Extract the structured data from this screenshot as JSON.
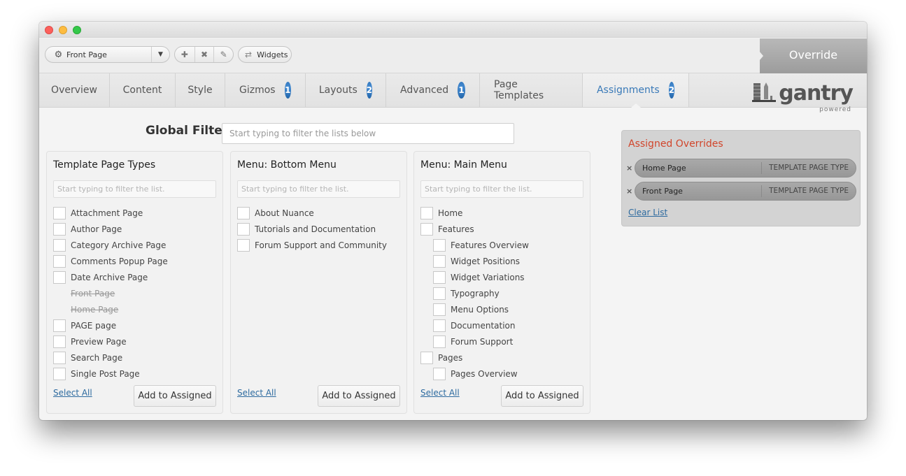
{
  "window": {
    "controls": [
      "close",
      "minimize",
      "maximize"
    ]
  },
  "toolbar": {
    "page_select": {
      "icon": "gear-icon",
      "value": "Front Page",
      "arrow": "▼"
    },
    "actions": [
      {
        "name": "add",
        "icon": "plus-icon",
        "glyph": "✚"
      },
      {
        "name": "delete",
        "icon": "x-icon",
        "glyph": "✖"
      },
      {
        "name": "rename",
        "icon": "pencil-icon",
        "glyph": "✎"
      }
    ],
    "widgets": {
      "icon": "refresh-icon",
      "glyph": "⇄",
      "label": "Widgets"
    },
    "override_label": "Override"
  },
  "tabs": [
    {
      "label": "Overview",
      "badge": null
    },
    {
      "label": "Content",
      "badge": null
    },
    {
      "label": "Style",
      "badge": null
    },
    {
      "label": "Gizmos",
      "badge": "1"
    },
    {
      "label": "Layouts",
      "badge": "2"
    },
    {
      "label": "Advanced",
      "badge": "1"
    },
    {
      "label": "Page Templates",
      "badge": null
    },
    {
      "label": "Assignments",
      "badge": "2",
      "active": true
    }
  ],
  "logo": {
    "brand": "gantry",
    "tagline": "powered"
  },
  "global_filter": {
    "label": "Global Filter",
    "placeholder": "Start typing to filter the lists below"
  },
  "panels": [
    {
      "title": "Template Page Types",
      "filter_placeholder": "Start typing to filter the list.",
      "items": [
        {
          "label": "Attachment Page",
          "state": "normal"
        },
        {
          "label": "Author Page",
          "state": "normal"
        },
        {
          "label": "Category Archive Page",
          "state": "normal"
        },
        {
          "label": "Comments Popup Page",
          "state": "normal"
        },
        {
          "label": "Date Archive Page",
          "state": "normal"
        },
        {
          "label": "Front Page",
          "state": "assigned"
        },
        {
          "label": "Home Page",
          "state": "assigned"
        },
        {
          "label": "PAGE page",
          "state": "normal"
        },
        {
          "label": "Preview Page",
          "state": "normal"
        },
        {
          "label": "Search Page",
          "state": "normal"
        },
        {
          "label": "Single Post Page",
          "state": "normal"
        }
      ],
      "select_all": "Select All",
      "add_button": "Add to Assigned"
    },
    {
      "title": "Menu: Bottom Menu",
      "filter_placeholder": "Start typing to filter the list.",
      "items": [
        {
          "label": "About Nuance",
          "state": "normal"
        },
        {
          "label": "Tutorials and Documentation",
          "state": "normal"
        },
        {
          "label": "Forum Support and Community",
          "state": "normal"
        }
      ],
      "select_all": "Select All",
      "add_button": "Add to Assigned"
    },
    {
      "title": "Menu: Main Menu",
      "filter_placeholder": "Start typing to filter the list.",
      "items": [
        {
          "label": "Home",
          "state": "normal"
        },
        {
          "label": "Features",
          "state": "normal"
        },
        {
          "label": "Features Overview",
          "state": "child"
        },
        {
          "label": "Widget Positions",
          "state": "child"
        },
        {
          "label": "Widget Variations",
          "state": "child"
        },
        {
          "label": "Typography",
          "state": "child"
        },
        {
          "label": "Menu Options",
          "state": "child"
        },
        {
          "label": "Documentation",
          "state": "child"
        },
        {
          "label": "Forum Support",
          "state": "child"
        },
        {
          "label": "Pages",
          "state": "normal"
        },
        {
          "label": "Pages Overview",
          "state": "child"
        }
      ],
      "select_all": "Select All",
      "add_button": "Add to Assigned"
    }
  ],
  "assigned": {
    "title": "Assigned Overrides",
    "title_color": "#d1452b",
    "items": [
      {
        "name": "Home Page",
        "type": "TEMPLATE PAGE TYPE"
      },
      {
        "name": "Front Page",
        "type": "TEMPLATE PAGE TYPE"
      }
    ],
    "remove_glyph": "×",
    "clear_label": "Clear List"
  },
  "colors": {
    "accent": "#3a7ab8",
    "badge": "#2a72bd",
    "link": "#2d6a9f"
  }
}
